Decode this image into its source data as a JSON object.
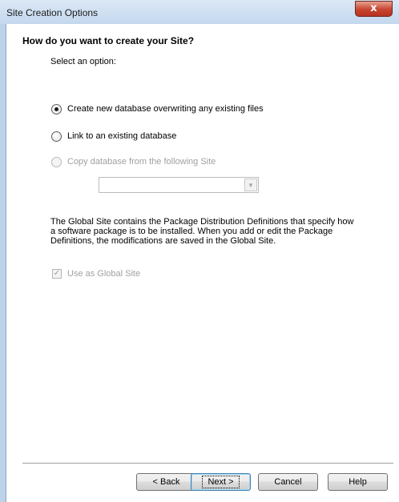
{
  "window": {
    "title": "Site Creation Options",
    "close_glyph": "x"
  },
  "main": {
    "heading": "How do you want to create your Site?",
    "select_label": "Select an option:",
    "options": [
      {
        "label": "Create new database overwriting any existing files",
        "checked": true,
        "enabled": true
      },
      {
        "label": "Link to an existing database",
        "checked": false,
        "enabled": true
      },
      {
        "label": "Copy database from the following Site",
        "checked": false,
        "enabled": false
      }
    ],
    "site_dropdown": {
      "value": "",
      "enabled": false
    },
    "description": "The Global Site contains the Package Distribution Definitions that specify how a software package is to be installed. When you add or edit the Package Definitions, the modifications are saved in the Global Site.",
    "global_site_checkbox": {
      "label": "Use as Global Site",
      "checked": true,
      "enabled": false
    }
  },
  "footer": {
    "back_label": "< Back",
    "next_label": "Next >",
    "cancel_label": "Cancel",
    "help_label": "Help"
  }
}
